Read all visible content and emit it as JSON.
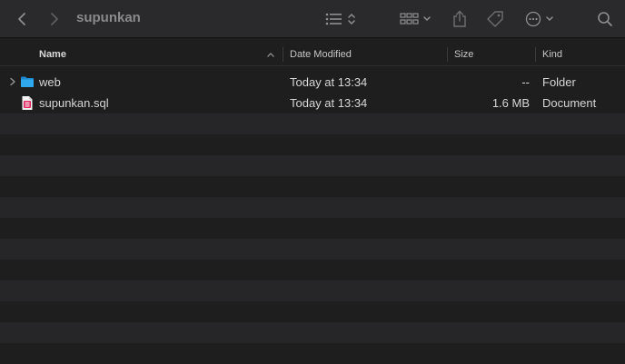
{
  "window": {
    "title": "supunkan"
  },
  "toolbar": {
    "icons": [
      "back-icon",
      "forward-icon",
      "list-view-icon",
      "group-icon",
      "share-icon",
      "tag-icon",
      "action-icon",
      "search-icon"
    ]
  },
  "columns": {
    "name": "Name",
    "date": "Date Modified",
    "size": "Size",
    "kind": "Kind"
  },
  "files": [
    {
      "name": "web",
      "date": "Today at 13:34",
      "size": "--",
      "kind": "Folder",
      "icon": "folder-icon"
    },
    {
      "name": "supunkan.sql",
      "date": "Today at 13:34",
      "size": "1.6 MB",
      "kind": "Document",
      "icon": "document-icon"
    }
  ],
  "colors": {
    "folder": "#29a3e8",
    "document": "#e0245e"
  }
}
